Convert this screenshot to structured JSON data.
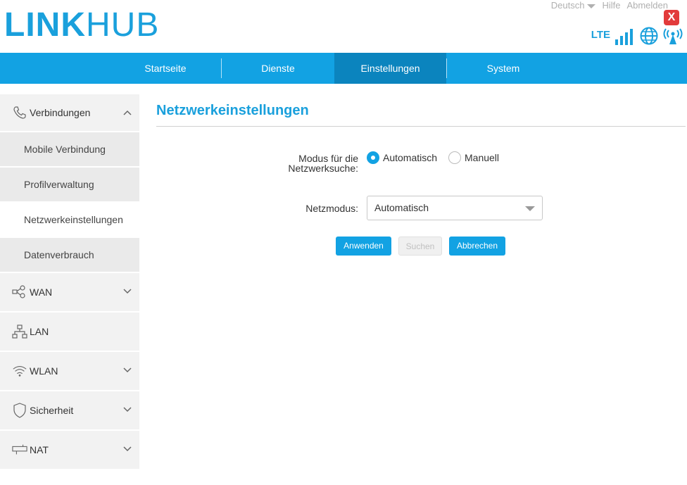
{
  "brand": {
    "logo_bold": "LINK",
    "logo_thin": "HUB",
    "accent": "#1aa0dc"
  },
  "toplinks": {
    "language": "Deutsch",
    "help": "Hilfe",
    "logout": "Abmelden"
  },
  "close_label": "X",
  "status": {
    "network": "LTE",
    "icons": [
      "signal-bars-icon",
      "globe-icon",
      "wifi-broadcast-icon"
    ]
  },
  "nav": {
    "items": [
      {
        "label": "Startseite",
        "active": false
      },
      {
        "label": "Dienste",
        "active": false
      },
      {
        "label": "Einstellungen",
        "active": true
      },
      {
        "label": "System",
        "active": false
      }
    ]
  },
  "sidebar": {
    "groups": [
      {
        "label": "Verbindungen",
        "icon": "phone-icon",
        "expanded": true
      },
      {
        "label": "WAN",
        "icon": "network-nodes-icon"
      },
      {
        "label": "LAN",
        "icon": "lan-icon"
      },
      {
        "label": "WLAN",
        "icon": "wifi-icon"
      },
      {
        "label": "Sicherheit",
        "icon": "shield-icon"
      },
      {
        "label": "NAT",
        "icon": "nat-icon"
      }
    ],
    "sub_items": [
      {
        "label": "Mobile Verbindung"
      },
      {
        "label": "Profilverwaltung"
      },
      {
        "label": "Netzwerkeinstellungen",
        "active": true
      },
      {
        "label": "Datenverbrauch"
      }
    ]
  },
  "main": {
    "title": "Netzwerkeinstellungen",
    "search_mode_label_line1": "Modus für die",
    "search_mode_label_line2": "Netzwerksuche:",
    "radio_auto": "Automatisch",
    "radio_manual": "Manuell",
    "selected_radio": "Automatisch",
    "netmode_label": "Netzmodus:",
    "netmode_value": "Automatisch",
    "buttons": {
      "apply": "Anwenden",
      "search": "Suchen",
      "cancel": "Abbrechen"
    }
  }
}
